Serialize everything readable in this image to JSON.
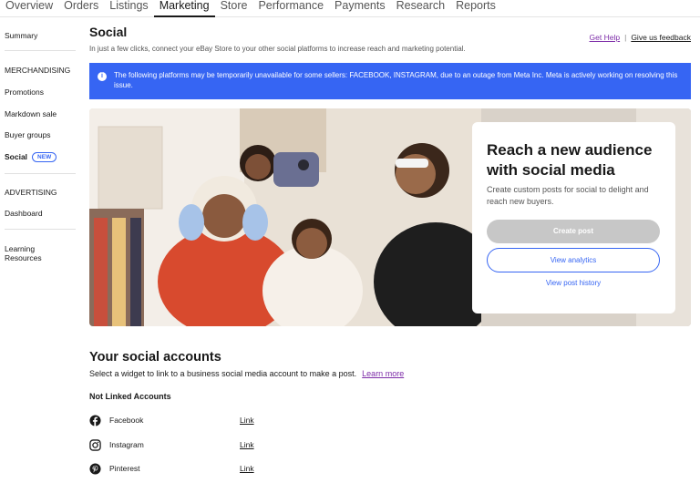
{
  "topnav": {
    "tabs": [
      "Overview",
      "Orders",
      "Listings",
      "Marketing",
      "Store",
      "Performance",
      "Payments",
      "Research",
      "Reports"
    ],
    "active": "Marketing"
  },
  "sidebar": {
    "summary": "Summary",
    "merch_header": "MERCHANDISING",
    "promotions": "Promotions",
    "markdown": "Markdown sale",
    "buyer_groups": "Buyer groups",
    "social": "Social",
    "social_badge": "NEW",
    "adv_header": "ADVERTISING",
    "dashboard": "Dashboard",
    "learning_1": "Learning",
    "learning_2": "Resources"
  },
  "page": {
    "title": "Social",
    "subtitle": "In just a few clicks, connect your eBay Store to your other social platforms to increase reach and marketing potential.",
    "get_help": "Get Help",
    "separator": "|",
    "feedback": "Give us feedback"
  },
  "alert": {
    "icon": "info-icon",
    "text": "The following platforms may be temporarily unavailable for some sellers: FACEBOOK, INSTAGRAM, due to an outage from Meta Inc. Meta is actively working on resolving this issue."
  },
  "hero": {
    "heading": "Reach a new audience with social media",
    "body": "Create custom posts for social to delight and reach new buyers.",
    "create_post": "Create post",
    "view_analytics": "View analytics",
    "view_history": "View post history"
  },
  "accounts": {
    "title": "Your social accounts",
    "subtitle": "Select a widget to link to a business social media account to make a post.",
    "learn_more": "Learn more",
    "not_linked": "Not Linked Accounts",
    "rows": [
      {
        "name": "Facebook",
        "icon": "facebook-icon",
        "link": "Link"
      },
      {
        "name": "Instagram",
        "icon": "instagram-icon",
        "link": "Link"
      },
      {
        "name": "Pinterest",
        "icon": "pinterest-icon",
        "link": "Link"
      }
    ]
  },
  "colors": {
    "accent_blue": "#3665f3",
    "link_purple": "#7d2ca8",
    "disabled_gray": "#c7c7c7"
  }
}
